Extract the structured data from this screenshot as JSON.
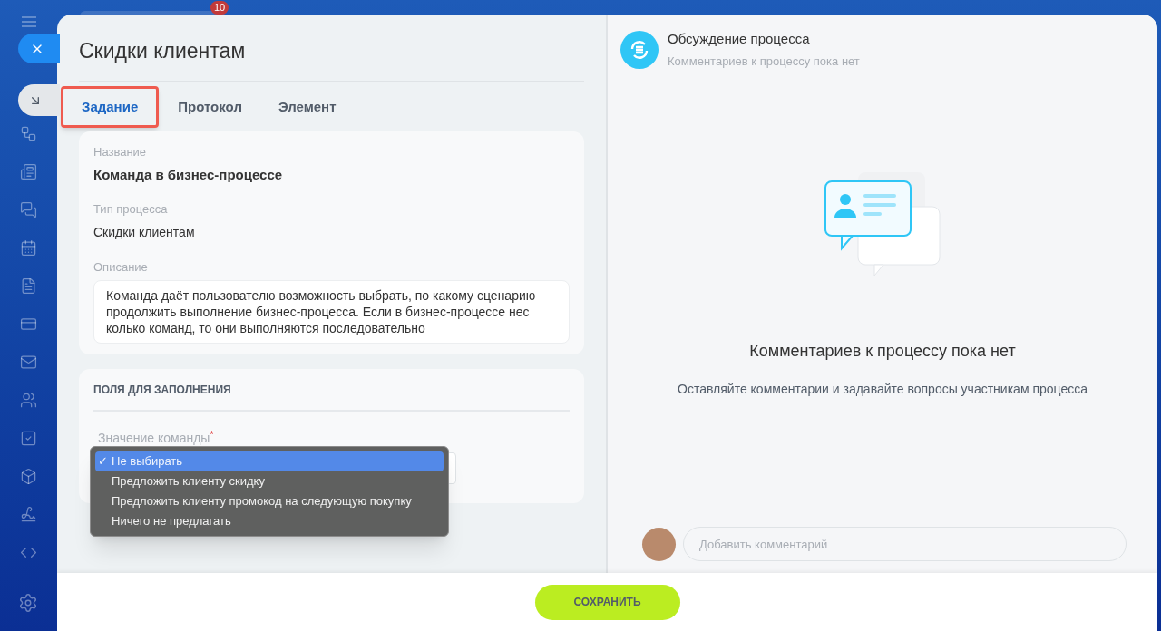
{
  "sidebar": {
    "badge": "10"
  },
  "title": "Скидки клиентам",
  "tabs": [
    {
      "label": "Задание",
      "selected": true,
      "highlighted": true
    },
    {
      "label": "Протокол",
      "selected": false,
      "highlighted": false
    },
    {
      "label": "Элемент",
      "selected": false,
      "highlighted": false
    }
  ],
  "info": {
    "name_label": "Название",
    "name": "Команда в бизнес-процессе",
    "type_label": "Тип процесса",
    "type": "Скидки клиентам",
    "description_label": "Описание",
    "description": "Команда даёт пользователю возможность выбрать, по какому сценарию продолжить выполнение бизнес-процесса. Если в бизнес-процессе нес колько команд, то они выполняются последовательно"
  },
  "fields": {
    "heading": "ПОЛЯ ДЛЯ ЗАПОЛНЕНИЯ",
    "label": "Значение команды",
    "required_mark": "*",
    "check_mark": "✓",
    "options": [
      {
        "label": "Не выбирать",
        "selected": true
      },
      {
        "label": "Предложить клиенту скидку",
        "selected": false
      },
      {
        "label": "Предложить клиенту промокод на следующую покупку",
        "selected": false
      },
      {
        "label": "Ничего не предлагать",
        "selected": false
      }
    ]
  },
  "discussion": {
    "title": "Обсуждение процесса",
    "subtitle": "Комментариев к процессу пока нет",
    "empty_title": "Комментариев к процессу пока нет",
    "empty_text": "Оставляйте комментарии и задавайте вопросы участникам процесса",
    "comment_placeholder": "Добавить комментарий"
  },
  "save_button": "СОХРАНИТЬ"
}
